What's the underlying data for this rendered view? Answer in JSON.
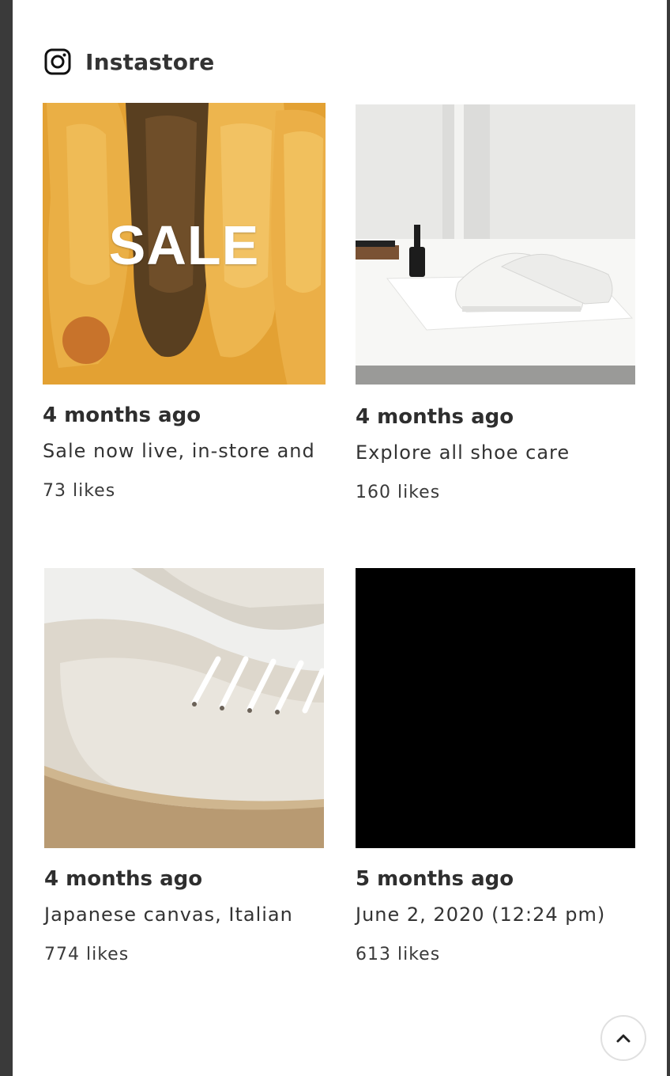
{
  "header": {
    "title": "Instastore",
    "icon": "instagram-icon"
  },
  "posts": [
    {
      "time": "4 months ago",
      "caption": "Sale now live, in-store and",
      "likes": "73 likes",
      "overlay_text": "SALE",
      "accent": "#e3a234"
    },
    {
      "time": "4 months ago",
      "caption": "Explore all shoe care",
      "likes": "160 likes"
    },
    {
      "time": "4 months ago",
      "caption": "Japanese canvas, Italian",
      "likes": "774 likes"
    },
    {
      "time": "5 months ago",
      "caption": "June 2, 2020 (12:24 pm)",
      "likes": "613 likes"
    }
  ],
  "scroll_top": {
    "icon": "chevron-up-icon"
  }
}
